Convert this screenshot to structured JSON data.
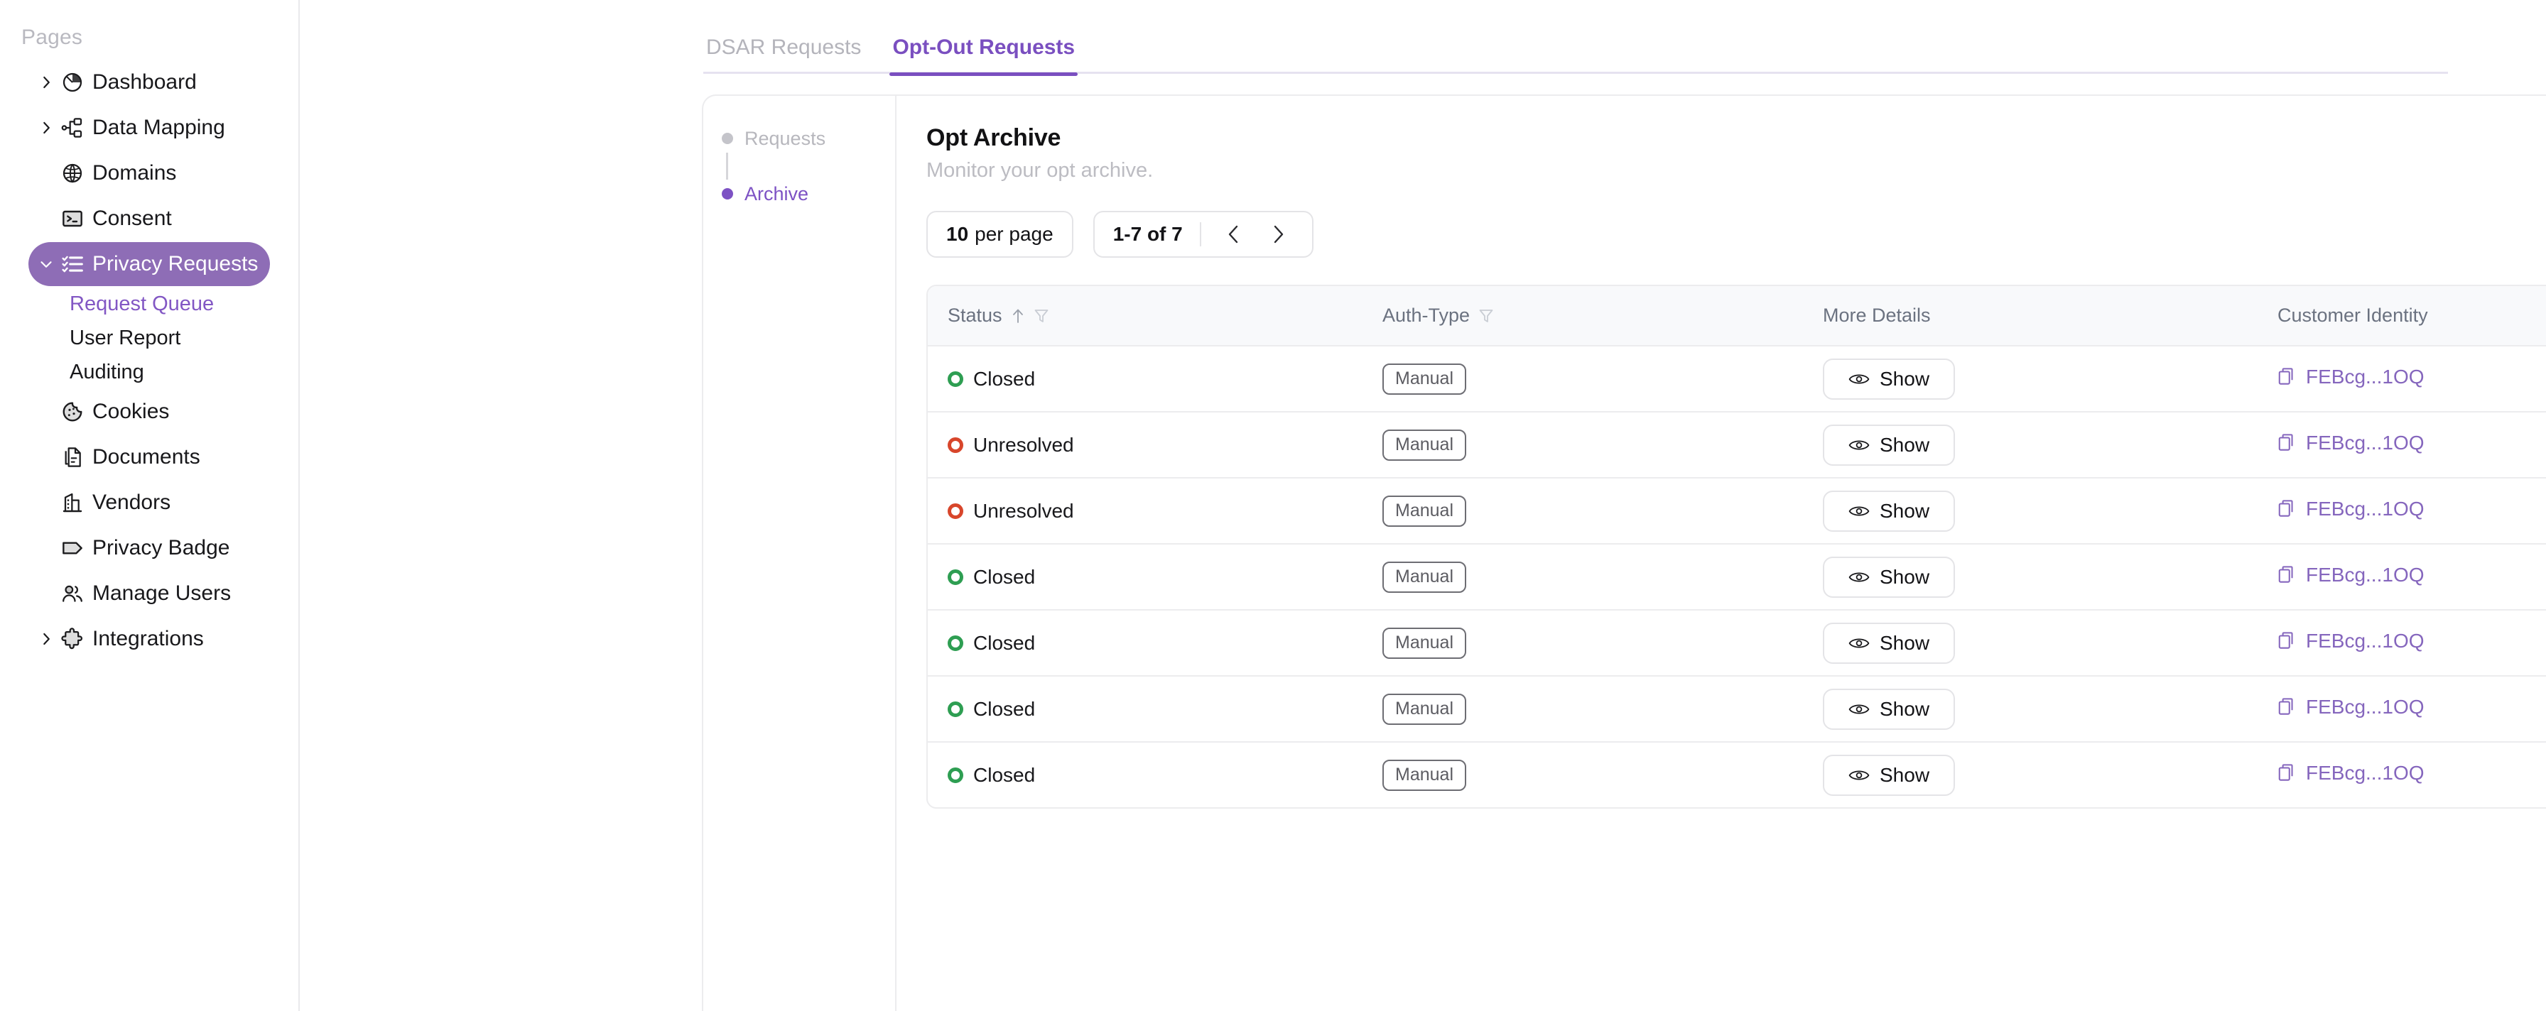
{
  "sidebar": {
    "heading": "Pages",
    "items": [
      {
        "label": "Dashboard",
        "icon": "pie-chart-icon",
        "expandable": true,
        "active": false
      },
      {
        "label": "Data Mapping",
        "icon": "data-mapping-icon",
        "expandable": true,
        "active": false
      },
      {
        "label": "Domains",
        "icon": "globe-icon",
        "expandable": false,
        "active": false
      },
      {
        "label": "Consent",
        "icon": "terminal-icon",
        "expandable": false,
        "active": false
      },
      {
        "label": "Privacy Requests",
        "icon": "checklist-icon",
        "expandable": true,
        "active": true
      },
      {
        "label": "Cookies",
        "icon": "cookie-icon",
        "expandable": false,
        "active": false
      },
      {
        "label": "Documents",
        "icon": "documents-icon",
        "expandable": false,
        "active": false
      },
      {
        "label": "Vendors",
        "icon": "building-icon",
        "expandable": false,
        "active": false
      },
      {
        "label": "Privacy Badge",
        "icon": "tag-icon",
        "expandable": false,
        "active": false
      },
      {
        "label": "Manage Users",
        "icon": "users-icon",
        "expandable": false,
        "active": false
      },
      {
        "label": "Integrations",
        "icon": "puzzle-icon",
        "expandable": true,
        "active": false
      }
    ],
    "subitems": [
      {
        "label": "Request Queue",
        "active": true
      },
      {
        "label": "User Report",
        "active": false
      },
      {
        "label": "Auditing",
        "active": false
      }
    ]
  },
  "tabs": [
    {
      "label": "DSAR Requests",
      "active": false
    },
    {
      "label": "Opt-Out Requests",
      "active": true
    }
  ],
  "stepper": [
    {
      "label": "Requests",
      "active": false
    },
    {
      "label": "Archive",
      "active": true
    }
  ],
  "panel": {
    "title": "Opt Archive",
    "subtitle": "Monitor your opt archive."
  },
  "pagination": {
    "per_page_count": "10",
    "per_page_suffix": "per page",
    "range": "1-7 of 7",
    "prev_icon": "chevron-left-icon",
    "next_icon": "chevron-right-icon"
  },
  "table": {
    "columns": [
      {
        "label": "Status",
        "sort": "↑",
        "filter": true
      },
      {
        "label": "Auth-Type",
        "sort": null,
        "filter": true
      },
      {
        "label": "More Details",
        "sort": null,
        "filter": false
      },
      {
        "label": "Customer Identity",
        "sort": null,
        "filter": false
      }
    ],
    "rows": [
      {
        "status": "Closed",
        "status_color": "green",
        "auth_type": "Manual",
        "details_label": "Show",
        "identity": "FEBcg...1OQ"
      },
      {
        "status": "Unresolved",
        "status_color": "red",
        "auth_type": "Manual",
        "details_label": "Show",
        "identity": "FEBcg...1OQ"
      },
      {
        "status": "Unresolved",
        "status_color": "red",
        "auth_type": "Manual",
        "details_label": "Show",
        "identity": "FEBcg...1OQ"
      },
      {
        "status": "Closed",
        "status_color": "green",
        "auth_type": "Manual",
        "details_label": "Show",
        "identity": "FEBcg...1OQ"
      },
      {
        "status": "Closed",
        "status_color": "green",
        "auth_type": "Manual",
        "details_label": "Show",
        "identity": "FEBcg...1OQ"
      },
      {
        "status": "Closed",
        "status_color": "green",
        "auth_type": "Manual",
        "details_label": "Show",
        "identity": "FEBcg...1OQ"
      },
      {
        "status": "Closed",
        "status_color": "green",
        "auth_type": "Manual",
        "details_label": "Show",
        "identity": "FEBcg...1OQ"
      }
    ]
  },
  "colors": {
    "accent": "#7a4fc0",
    "accent_active_bg": "#8e6db6",
    "status_green": "#2e9e52",
    "status_red": "#d8462b",
    "identity_link": "#8566bd",
    "muted": "#b7b7bd"
  }
}
